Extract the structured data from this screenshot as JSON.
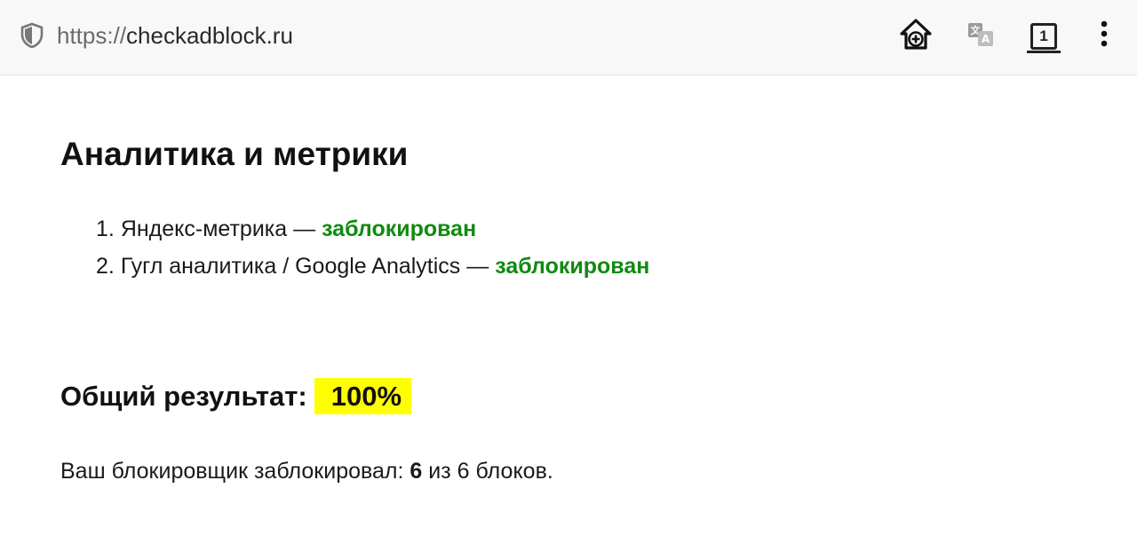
{
  "browser": {
    "url_scheme": "https://",
    "url_host": "checkadblock.ru",
    "tab_count": "1",
    "icons": [
      "shield-icon",
      "add-to-home-icon",
      "translate-icon",
      "tabs-icon",
      "more-vert-icon"
    ]
  },
  "page": {
    "section_title": "Аналитика и метрики",
    "items": [
      {
        "number": "1.",
        "label": "Яндекс-метрика —",
        "status": "заблокирован"
      },
      {
        "number": "2.",
        "label": "Гугл аналитика / Google Analytics —",
        "status": "заблокирован"
      }
    ],
    "result_label": "Общий результат:",
    "result_value": "100%",
    "summary_prefix": "Ваш блокировщик заблокировал:",
    "summary_blocked": "6",
    "summary_suffix": "из 6 блоков."
  },
  "colors": {
    "status_ok": "#118a11",
    "highlight": "#ffff00",
    "toolbar_bg": "#f8f8f8"
  }
}
